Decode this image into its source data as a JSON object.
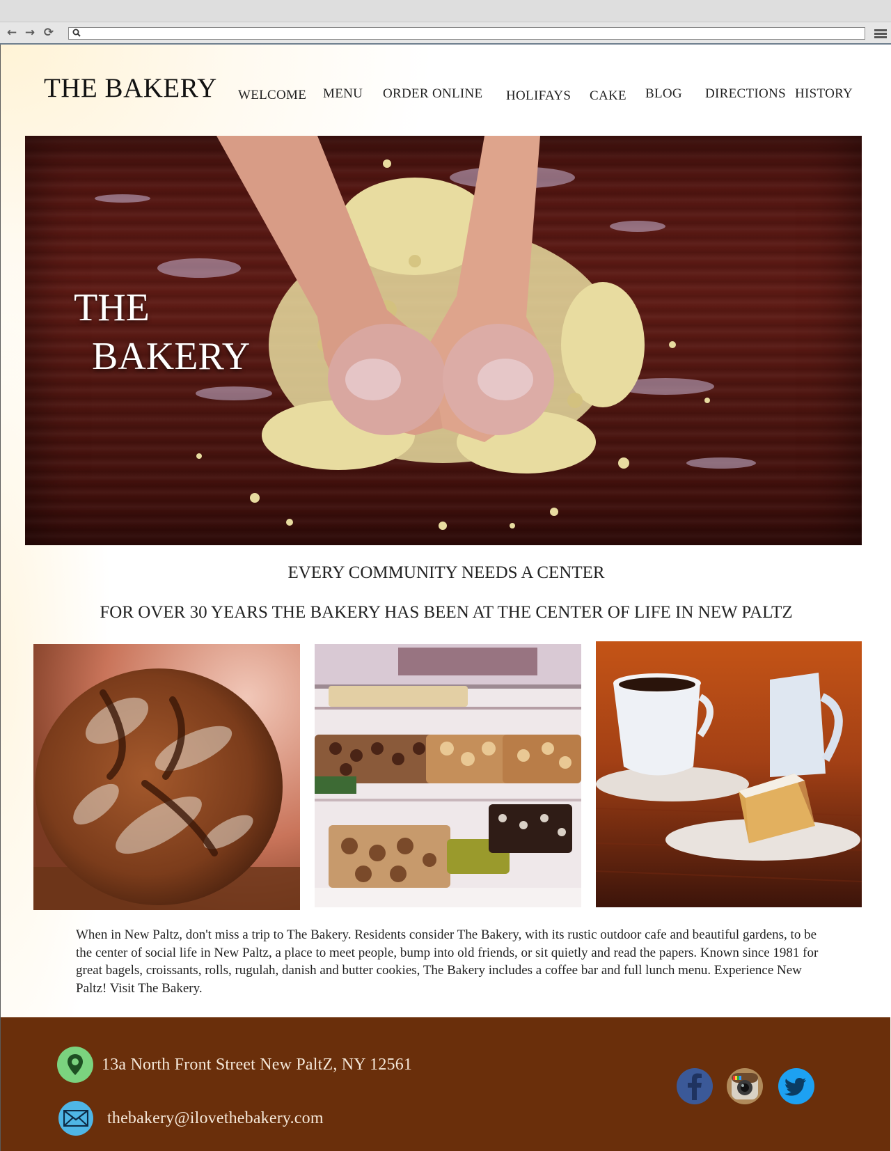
{
  "browser": {
    "back_icon": "arrow-left-icon",
    "forward_icon": "arrow-right-icon",
    "reload_icon": "reload-icon",
    "search_icon": "search-icon",
    "menu_icon": "hamburger-menu-icon",
    "url_value": ""
  },
  "header": {
    "logo": "THE BAKERY",
    "nav": [
      {
        "label": "WELCOME"
      },
      {
        "label": "MENU"
      },
      {
        "label": "ORDER ONLINE"
      },
      {
        "label": "HOLIFAYS"
      },
      {
        "label": "CAKE"
      },
      {
        "label": "BLOG"
      },
      {
        "label": "DIRECTIONS"
      },
      {
        "label": "HISTORY"
      }
    ]
  },
  "hero": {
    "title_line1": "THE",
    "title_line2": "BAKERY"
  },
  "main": {
    "tagline": "EVERY COMMUNITY NEEDS A CENTER",
    "subtagline": "FOR OVER 30 YEARS THE BAKERY HAS BEEN AT THE CENTER OF LIFE IN NEW PALTZ",
    "description": "When in New Paltz, don't miss a trip to The Bakery. Residents consider The Bakery, with its rustic outdoor cafe and beautiful gardens, to be the center of social life in New Paltz,  a place to meet people, bump into old friends, or sit quietly and read the papers. Known since 1981 for great bagels, croissants, rolls, rugulah, danish and butter cookies, The Bakery includes a coffee bar and full lunch menu. Experience New Paltz! Visit The Bakery."
  },
  "footer": {
    "address": "13a North Front Street New PaltZ, NY 12561",
    "email": "thebakery@ilovethebakery.com",
    "address_icon": "location-pin-icon",
    "email_icon": "envelope-icon",
    "social": [
      "facebook-icon",
      "instagram-icon",
      "twitter-icon"
    ]
  },
  "colors": {
    "footer_bg": "#6a2f0b",
    "pin_green": "#7bd37f",
    "mail_blue": "#4fb6e6",
    "facebook": "#3b5998",
    "twitter": "#1da1f2"
  }
}
